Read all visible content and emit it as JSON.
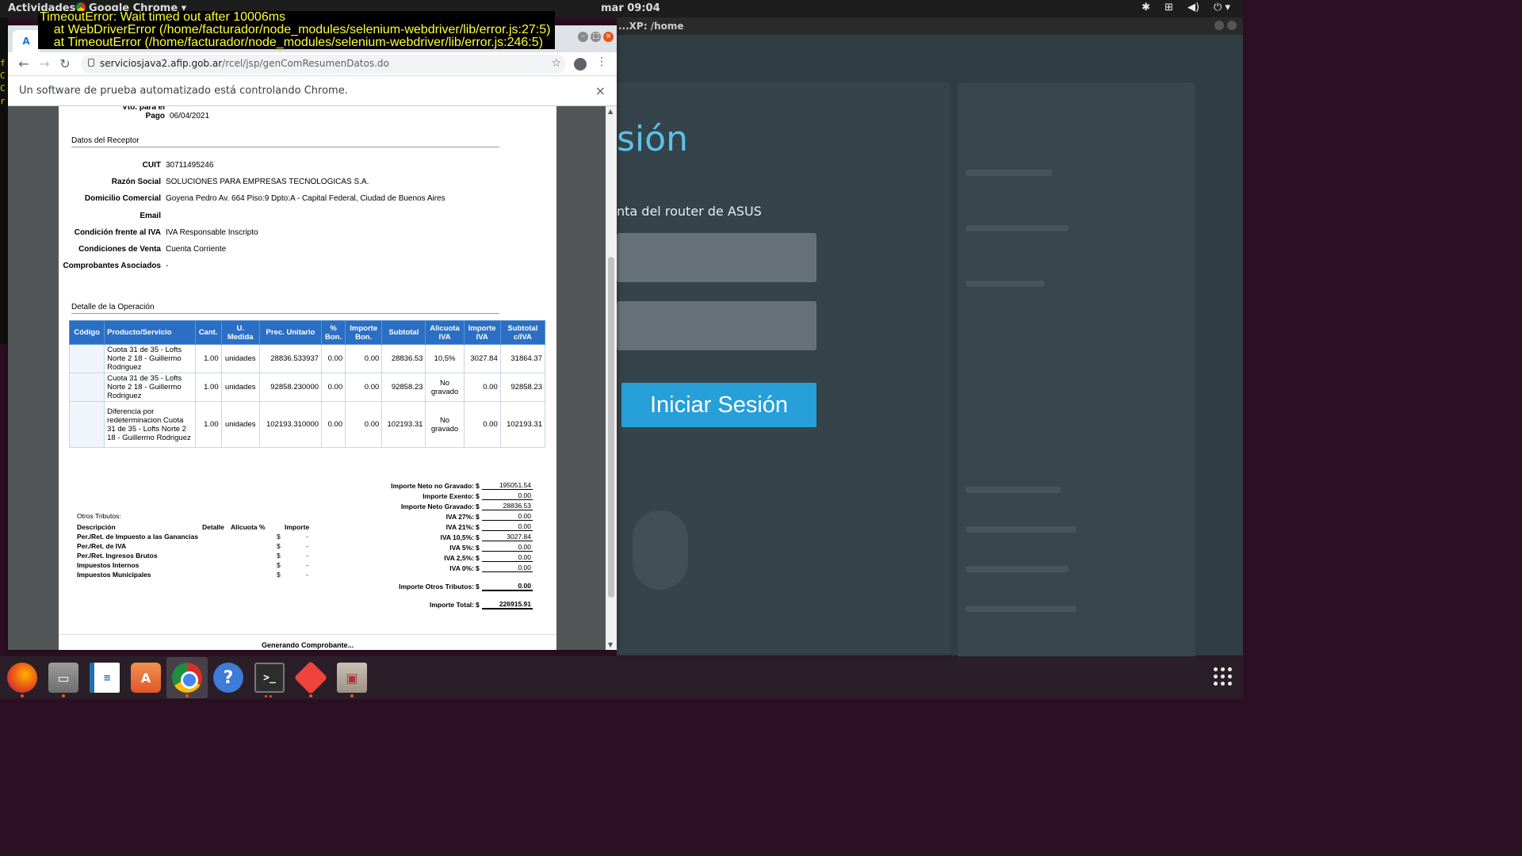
{
  "topbar": {
    "activities": "Actividades",
    "app_name": "Google Chrome ▾",
    "clock": "mar 09:04",
    "tray_icons": [
      "bluetooth-icon",
      "network-icon",
      "volume-icon",
      "power-icon"
    ]
  },
  "left_strip_chars": [
    "f",
    "C",
    "C",
    "r"
  ],
  "background_window": {
    "title": "...XP: /home",
    "heading_fragment": "sión",
    "subtitle_fragment": "nta del router de ASUS",
    "login_button": "Iniciar Sesión"
  },
  "error": {
    "line1": "TimeoutError: Wait timed out after 10006ms",
    "line2": "    at WebDriverError (/home/facturador/node_modules/selenium-webdriver/lib/error.js:27:5)",
    "line3": "    at TimeoutError (/home/facturador/node_modules/selenium-webdriver/lib/error.js:246:5)"
  },
  "browser": {
    "url_host": "serviciosjava2.afip.gob.ar",
    "url_path": "/rcel/jsp/genComResumenDatos.do",
    "infobar": "Un software de prueba automatizado está controlando Chrome.",
    "tab_icon": "A"
  },
  "doc": {
    "vto_label": "Vto. para el Pago",
    "vto_value": "06/04/2021",
    "receptor_title": "Datos del Receptor",
    "receptor": [
      {
        "k": "CUIT",
        "v": "30711495246"
      },
      {
        "k": "Razón Social",
        "v": "SOLUCIONES PARA EMPRESAS TECNOLOGICAS S.A."
      },
      {
        "k": "Domicilio Comercial",
        "v": "Goyena Pedro Av. 664 Piso:9 Dpto:A - Capital Federal, Ciudad de Buenos Aires"
      },
      {
        "k": "Email",
        "v": ""
      },
      {
        "k": "Condición frente al IVA",
        "v": "IVA Responsable Inscripto"
      },
      {
        "k": "Condiciones de Venta",
        "v": "Cuenta Corriente"
      },
      {
        "k": "Comprobantes Asociados",
        "v": "-"
      }
    ],
    "detalle_title": "Detalle de la Operación",
    "table_headers": [
      "Código",
      "Producto/Servicio",
      "Cant.",
      "U. Medida",
      "Prec. Unitario",
      "% Bon.",
      "Importe Bon.",
      "Subtotal",
      "Alicuota IVA",
      "Importe IVA",
      "Subtotal c/IVA"
    ],
    "rows": [
      [
        "",
        "Cuota 31 de 35 - Lofts Norte 2 18 - Guillermo Rodriguez",
        "1.00",
        "unidades",
        "28836.533937",
        "0.00",
        "0.00",
        "28836.53",
        "10,5%",
        "3027.84",
        "31864.37"
      ],
      [
        "",
        "Cuota 31 de 35 - Lofts Norte 2 18 - Guillermo Rodriguez",
        "1.00",
        "unidades",
        "92858.230000",
        "0.00",
        "0.00",
        "92858.23",
        "No gravado",
        "0.00",
        "92858.23"
      ],
      [
        "",
        "Diferencia por redeterminacion Cuota 31 de 35 - Lofts Norte 2 18 - Guillermo Rodriguez",
        "1.00",
        "unidades",
        "102193.310000",
        "0.00",
        "0.00",
        "102193.31",
        "No gravado",
        "0.00",
        "102193.31"
      ]
    ],
    "totals": [
      {
        "label": "Importe Neto no Gravado:",
        "value": "195051.54"
      },
      {
        "label": "Importe Exento:",
        "value": "0.00"
      },
      {
        "label": "Importe Neto Gravado:",
        "value": "28836.53"
      },
      {
        "label": "IVA 27%:",
        "value": "0.00"
      },
      {
        "label": "IVA 21%:",
        "value": "0.00"
      },
      {
        "label": "IVA 10,5%:",
        "value": "3027.84"
      },
      {
        "label": "IVA 5%:",
        "value": "0.00"
      },
      {
        "label": "IVA 2,5%:",
        "value": "0.00"
      },
      {
        "label": "IVA 0%:",
        "value": "0.00"
      }
    ],
    "otros_total": {
      "label": "Importe Otros Tributos:",
      "value": "0.00"
    },
    "total": {
      "label": "Importe Total:",
      "value": "226915.91"
    },
    "currency": "$",
    "otros": {
      "title": "Otros Tributos:",
      "headers": [
        "Descripción",
        "Detalle",
        "Alícuota %",
        "Importe"
      ],
      "rows": [
        "Per./Ret. de Impuesto a las Ganancias",
        "Per./Ret. de IVA",
        "Per./Ret. Ingresos Brutos",
        "Impuestos Internos",
        "Impuestos Municipales"
      ],
      "dash": "-"
    },
    "generating": "Generando Comprobante..."
  },
  "dock_apps": [
    "firefox-icon",
    "files-icon",
    "writer-icon",
    "software-icon",
    "chrome-icon",
    "help-icon",
    "terminal-icon",
    "anydesk-icon",
    "archive-icon"
  ]
}
